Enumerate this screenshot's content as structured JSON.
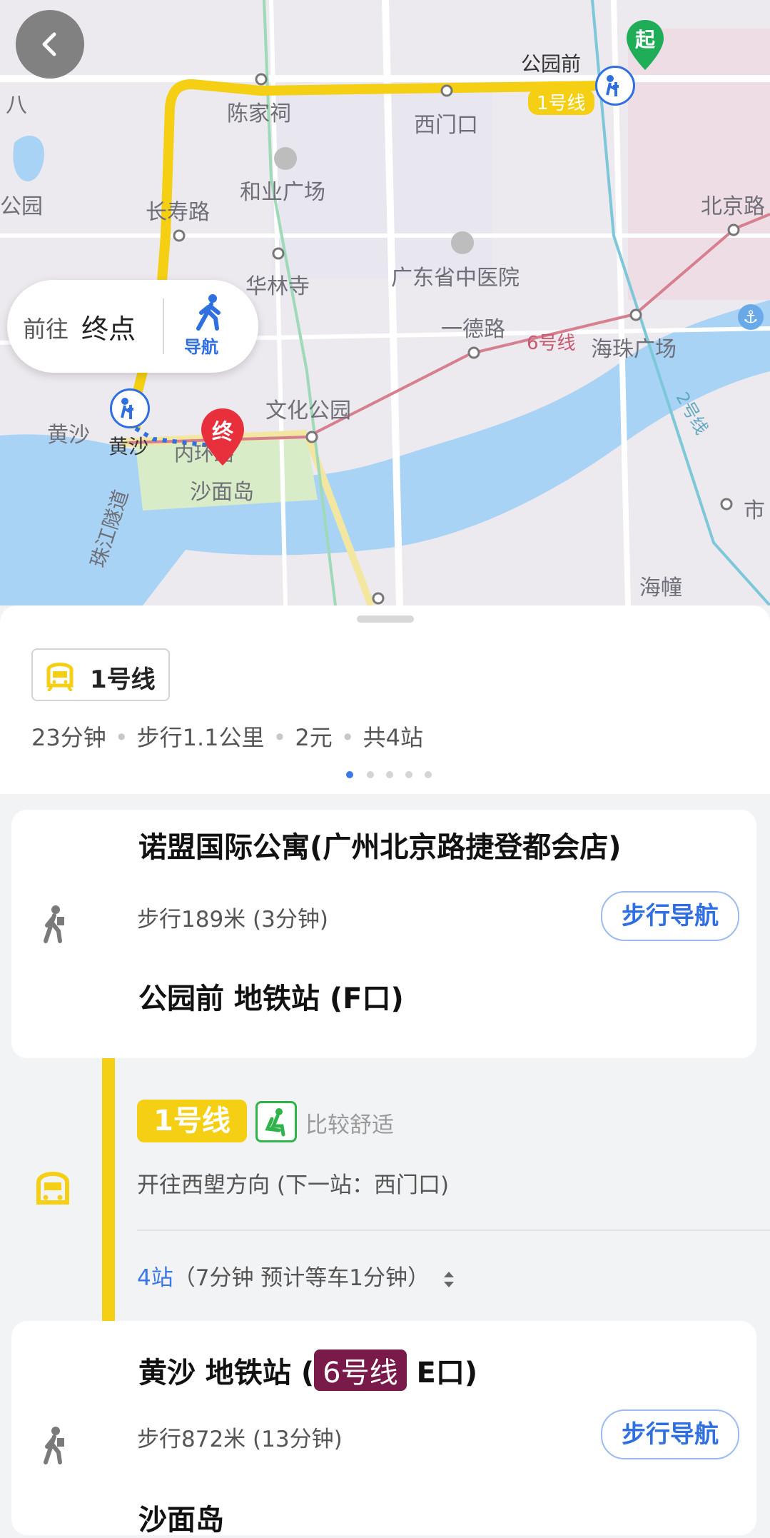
{
  "map": {
    "labels": {
      "gongyuanqian": "公园前",
      "chenjiaci": "陈家祠",
      "ximenkou": "西门口",
      "heye": "和业广场",
      "changshou": "长寿路",
      "hualin": "华林寺",
      "tcm_hospital": "广东省中医院",
      "beijinglu": "北京路",
      "yidelu": "一德路",
      "haizhu_square": "海珠广场",
      "huangsha_left": "黄沙",
      "huangsha_station": "黄沙",
      "wenhua_park": "文化公园",
      "neihuanlu": "内环路",
      "shamian": "沙面岛",
      "tunnel": "珠江隧道",
      "haizhuang": "海幢",
      "shi": "市",
      "park_left": "公园",
      "ba": "八",
      "line1": "1号线",
      "line6": "6号线",
      "line2": "2号线",
      "start_marker": "起",
      "end_marker": "终"
    },
    "nav_pill": {
      "goto": "前往",
      "destination": "终点",
      "nav_label": "导航"
    },
    "colors": {
      "line1": "#f5cf14",
      "line6": "#d57f8f",
      "start": "#1fae57",
      "end": "#e8303d",
      "water": "#a9d3f5"
    }
  },
  "route": {
    "line_tag": "1号线",
    "summary": [
      "23分钟",
      "步行1.1公里",
      "2元",
      "共4站"
    ],
    "pages": 5,
    "active_page": 0
  },
  "steps": {
    "origin": "诺盟国际公寓(广州北京路捷登都会店)",
    "walk1": "步行189米 (3分钟)",
    "walk_nav_button": "步行导航",
    "board_station": "公园前 地铁站 (F口)",
    "metro_line": "1号线",
    "comfort": "比较舒适",
    "direction": "开往西塱方向 (下一站：西门口)",
    "stops_count": "4站",
    "stops_detail": "（7分钟 预计等车1分钟）",
    "alight_station_name": "黄沙 地铁站 (",
    "alight_transfer_line": "6号线",
    "alight_exit": " E口)",
    "walk2": "步行872米 (13分钟)",
    "destination": "沙面岛"
  }
}
